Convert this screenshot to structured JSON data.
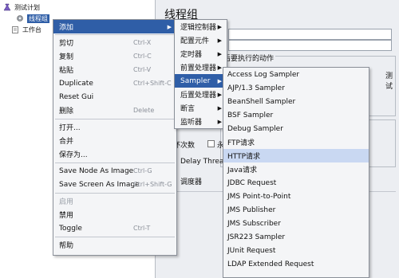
{
  "tree": {
    "test_plan": "测试计划",
    "thread_group": "线程组",
    "workbench": "工作台"
  },
  "right_panel": {
    "title": "线程组",
    "action_label": "后要执行的动作",
    "test_label": "测试",
    "loop_label": "环次数",
    "forever_label": "永",
    "delay_label": "Delay Thread",
    "scheduler_label": "调度器"
  },
  "menu_main": {
    "items": [
      {
        "label": "添加"
      },
      {
        "label": "剪切",
        "shortcut": "Ctrl-X"
      },
      {
        "label": "复制",
        "shortcut": "Ctrl-C"
      },
      {
        "label": "粘贴",
        "shortcut": "Ctrl-V"
      },
      {
        "label": "Duplicate",
        "shortcut": "Ctrl+Shift-C"
      },
      {
        "label": "Reset Gui"
      },
      {
        "label": "删除",
        "shortcut": "Delete"
      },
      {
        "label": "打开..."
      },
      {
        "label": "合并"
      },
      {
        "label": "保存为..."
      },
      {
        "label": "Save Node As Image",
        "shortcut": "Ctrl-G"
      },
      {
        "label": "Save Screen As Image",
        "shortcut": "Ctrl+Shift-G"
      },
      {
        "label": "启用"
      },
      {
        "label": "禁用"
      },
      {
        "label": "Toggle",
        "shortcut": "Ctrl-T"
      },
      {
        "label": "帮助"
      }
    ]
  },
  "menu_add": {
    "items": [
      {
        "label": "逻辑控制器"
      },
      {
        "label": "配置元件"
      },
      {
        "label": "定时器"
      },
      {
        "label": "前置处理器"
      },
      {
        "label": "Sampler"
      },
      {
        "label": "后置处理器"
      },
      {
        "label": "断言"
      },
      {
        "label": "监听器"
      }
    ]
  },
  "menu_sampler": {
    "items": [
      "Access Log Sampler",
      "AJP/1.3 Sampler",
      "BeanShell Sampler",
      "BSF Sampler",
      "Debug Sampler",
      "FTP请求",
      "HTTP请求",
      "Java请求",
      "JDBC Request",
      "JMS Point-to-Point",
      "JMS Publisher",
      "JMS Subscriber",
      "JSR223 Sampler",
      "JUnit Request",
      "LDAP Extended Request"
    ]
  },
  "colors": {
    "highlight": "#2f5ea7",
    "hover": "#c9d8f2",
    "menu_bg": "#f4f5f7"
  }
}
